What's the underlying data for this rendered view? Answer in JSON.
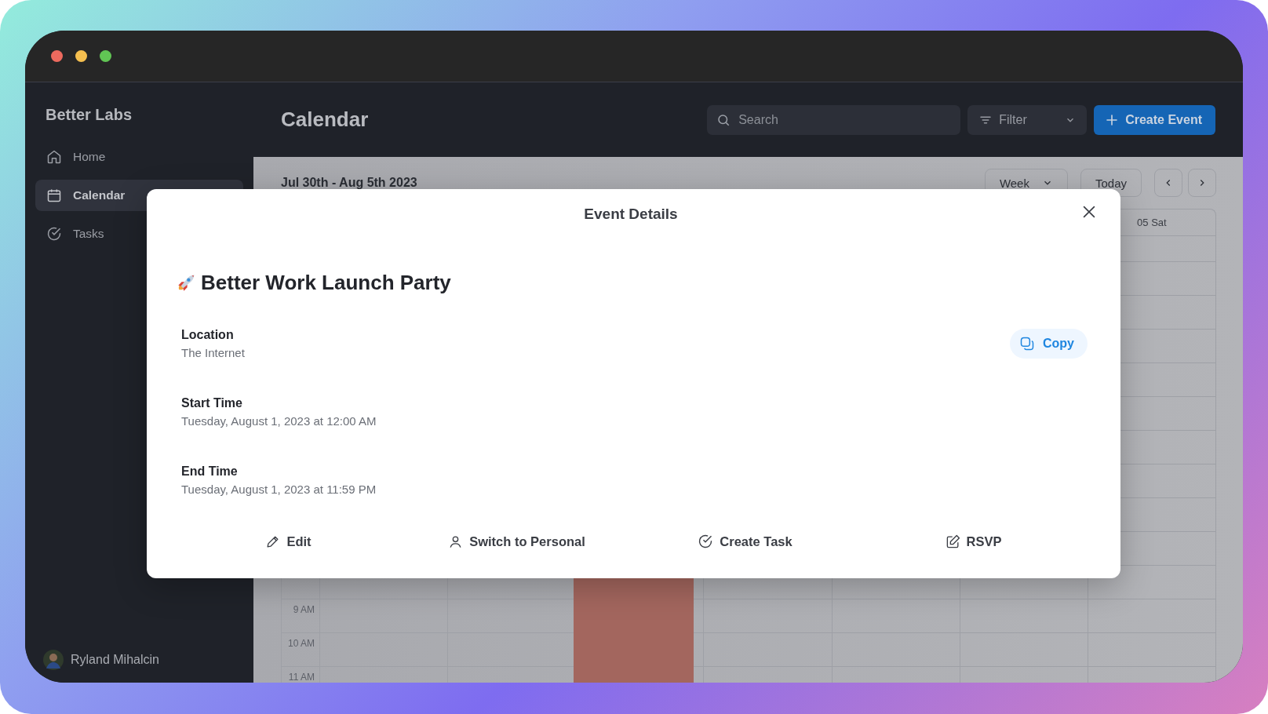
{
  "window": {
    "controls": [
      {
        "kind": "close"
      },
      {
        "kind": "minimize"
      },
      {
        "kind": "zoom"
      }
    ]
  },
  "sidebar": {
    "brand": "Better Labs",
    "items": [
      {
        "label": "Home",
        "kind": "home",
        "selected": false
      },
      {
        "label": "Calendar",
        "kind": "calendar",
        "selected": true
      },
      {
        "label": "Tasks",
        "kind": "tasks",
        "selected": false
      }
    ],
    "user": {
      "name": "Ryland Mihalcin"
    }
  },
  "header": {
    "title": "Calendar",
    "search": {
      "placeholder": "Search"
    },
    "filter": {
      "label": "Filter"
    },
    "create_button": {
      "label": "Create Event"
    }
  },
  "calendar": {
    "range": "Jul 30th - Aug 5th 2023",
    "view": "Week",
    "today_button": "Today",
    "visible_day_header": "05 Sat",
    "time_labels": [
      "9 AM",
      "10 AM",
      "11 AM"
    ]
  },
  "modal": {
    "title": "Event Details",
    "event_title": "Better Work Launch Party",
    "fields": [
      {
        "label": "Location",
        "value": "The Internet",
        "copy_button": "Copy"
      },
      {
        "label": "Start Time",
        "value": "Tuesday, August 1, 2023 at 12:00 AM"
      },
      {
        "label": "End Time",
        "value": "Tuesday, August 1, 2023 at 11:59 PM"
      }
    ],
    "actions": [
      {
        "label": "Edit",
        "kind": "edit"
      },
      {
        "label": "Switch to Personal",
        "kind": "switch"
      },
      {
        "label": "Create Task",
        "kind": "task"
      },
      {
        "label": "RSVP",
        "kind": "rsvp"
      }
    ]
  }
}
